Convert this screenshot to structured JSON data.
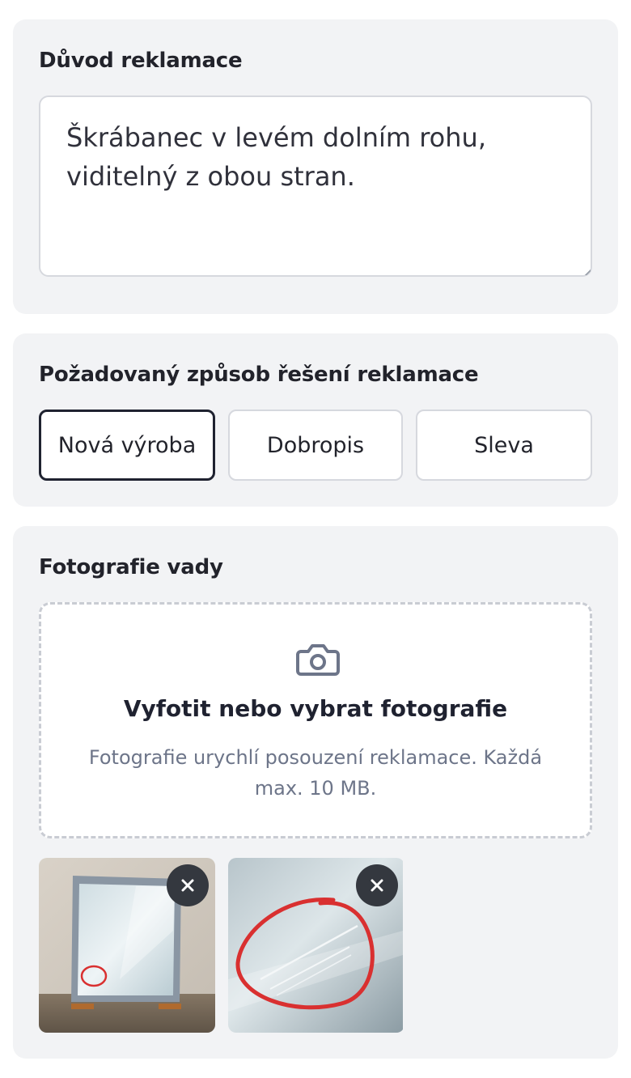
{
  "reason": {
    "title": "Důvod reklamace",
    "value": "Škrábanec v levém dolním rohu,\nviditelný z obou stran."
  },
  "resolution": {
    "title": "Požadovaný způsob řešení reklamace",
    "options": [
      {
        "label": "Nová výroba",
        "selected": true
      },
      {
        "label": "Dobropis",
        "selected": false
      },
      {
        "label": "Sleva",
        "selected": false
      }
    ]
  },
  "photos": {
    "title": "Fotografie vady",
    "dropzone": {
      "icon": "camera-icon",
      "title": "Vyfotit nebo vybrat fotografie",
      "hint": "Fotografie urychlí posouzení reklamace. Každá max. 10 MB."
    },
    "thumbnails": [
      {
        "description": "framed glass pane with circled scratch",
        "remove_icon": "close-icon"
      },
      {
        "description": "close-up of scratches circled in red",
        "remove_icon": "close-icon"
      }
    ]
  },
  "colors": {
    "card_bg": "#f2f3f5",
    "border": "#d6d8de",
    "selected_border": "#1f2230",
    "muted_text": "#6d7589",
    "accent_red": "#d93030"
  }
}
